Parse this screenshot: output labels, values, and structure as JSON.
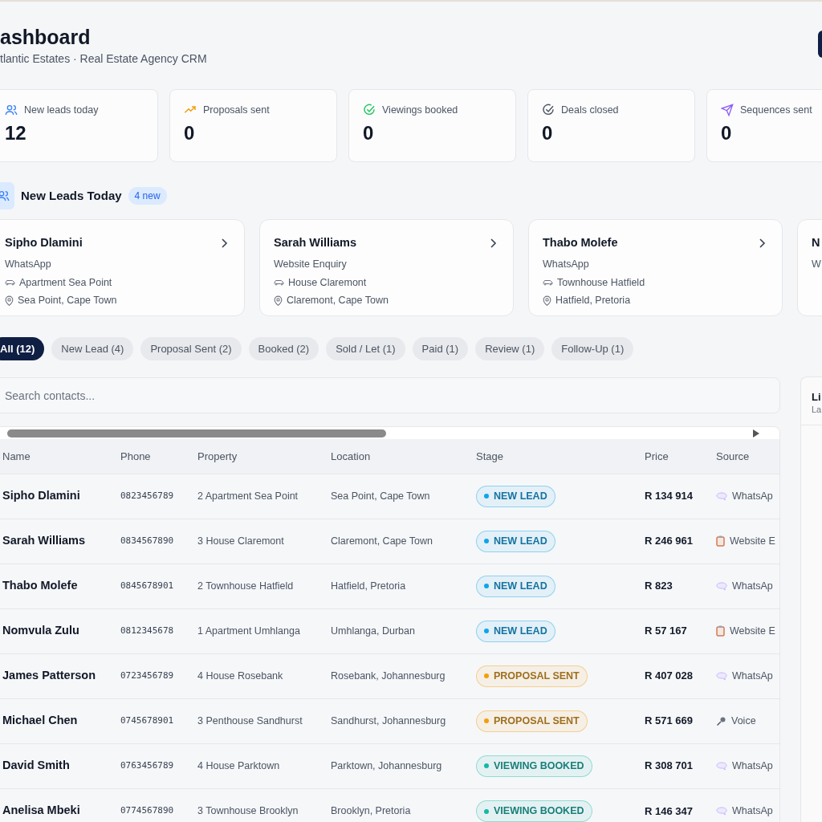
{
  "header": {
    "title": "ashboard",
    "subtitle": "tlantic Estates · Real Estate Agency CRM"
  },
  "stats": [
    {
      "label": "New leads today",
      "value": "12"
    },
    {
      "label": "Proposals sent",
      "value": "0"
    },
    {
      "label": "Viewings booked",
      "value": "0"
    },
    {
      "label": "Deals closed",
      "value": "0"
    },
    {
      "label": "Sequences sent",
      "value": "0"
    }
  ],
  "new_leads": {
    "title": "New Leads Today",
    "badge": "4 new",
    "cards": [
      {
        "name": "Sipho Dlamini",
        "source": "WhatsApp",
        "property": "Apartment Sea Point",
        "location": "Sea Point, Cape Town"
      },
      {
        "name": "Sarah Williams",
        "source": "Website Enquiry",
        "property": "House Claremont",
        "location": "Claremont, Cape Town"
      },
      {
        "name": "Thabo Molefe",
        "source": "WhatsApp",
        "property": "Townhouse Hatfield",
        "location": "Hatfield, Pretoria"
      },
      {
        "name": "N",
        "source": "W"
      }
    ]
  },
  "filters": [
    {
      "label": "All (12)",
      "selected": true
    },
    {
      "label": "New Lead (4)",
      "selected": false
    },
    {
      "label": "Proposal Sent (2)",
      "selected": false
    },
    {
      "label": "Booked (2)",
      "selected": false
    },
    {
      "label": "Sold / Let (1)",
      "selected": false
    },
    {
      "label": "Paid (1)",
      "selected": false
    },
    {
      "label": "Review (1)",
      "selected": false
    },
    {
      "label": "Follow-Up (1)",
      "selected": false
    }
  ],
  "search": {
    "placeholder": "Search contacts..."
  },
  "table": {
    "columns": [
      "Name",
      "Phone",
      "Property",
      "Location",
      "Stage",
      "Price",
      "Source"
    ],
    "rows": [
      {
        "name": "Sipho Dlamini",
        "phone": "0823456789",
        "property": "2 Apartment Sea Point",
        "location": "Sea Point, Cape Town",
        "stage": {
          "label": "NEW LEAD",
          "color": "#0ea5e9"
        },
        "price": "R 134 914",
        "source": {
          "kind": "chat",
          "label": "WhatsAp"
        }
      },
      {
        "name": "Sarah Williams",
        "phone": "0834567890",
        "property": "3 House Claremont",
        "location": "Claremont, Cape Town",
        "stage": {
          "label": "NEW LEAD",
          "color": "#0ea5e9"
        },
        "price": "R 246 961",
        "source": {
          "kind": "form",
          "label": "Website E"
        }
      },
      {
        "name": "Thabo Molefe",
        "phone": "0845678901",
        "property": "2 Townhouse Hatfield",
        "location": "Hatfield, Pretoria",
        "stage": {
          "label": "NEW LEAD",
          "color": "#0ea5e9"
        },
        "price": "R 823",
        "source": {
          "kind": "chat",
          "label": "WhatsAp"
        }
      },
      {
        "name": "Nomvula Zulu",
        "phone": "0812345678",
        "property": "1 Apartment Umhlanga",
        "location": "Umhlanga, Durban",
        "stage": {
          "label": "NEW LEAD",
          "color": "#0ea5e9"
        },
        "price": "R 57 167",
        "source": {
          "kind": "form",
          "label": "Website E"
        }
      },
      {
        "name": "James Patterson",
        "phone": "0723456789",
        "property": "4 House Rosebank",
        "location": "Rosebank, Johannesburg",
        "stage": {
          "label": "PROPOSAL SENT",
          "color": "#f59e0b"
        },
        "price": "R 407 028",
        "source": {
          "kind": "chat",
          "label": "WhatsAp"
        }
      },
      {
        "name": "Michael Chen",
        "phone": "0745678901",
        "property": "3 Penthouse Sandhurst",
        "location": "Sandhurst, Johannesburg",
        "stage": {
          "label": "PROPOSAL SENT",
          "color": "#f59e0b"
        },
        "price": "R 571 669",
        "source": {
          "kind": "voice",
          "label": "Voice"
        }
      },
      {
        "name": "David Smith",
        "phone": "0763456789",
        "property": "4 House Parktown",
        "location": "Parktown, Johannesburg",
        "stage": {
          "label": "VIEWING BOOKED",
          "color": "#14b8a6"
        },
        "price": "R 308 701",
        "source": {
          "kind": "chat",
          "label": "WhatsAp"
        }
      },
      {
        "name": "Anelisa Mbeki",
        "phone": "0774567890",
        "property": "3 Townhouse Brooklyn",
        "location": "Brooklyn, Pretoria",
        "stage": {
          "label": "VIEWING BOOKED",
          "color": "#14b8a6"
        },
        "price": "R 146 347",
        "source": {
          "kind": "chat",
          "label": "WhatsAp"
        }
      }
    ]
  },
  "side_panel": {
    "title": "Li",
    "subtitle": "La"
  }
}
